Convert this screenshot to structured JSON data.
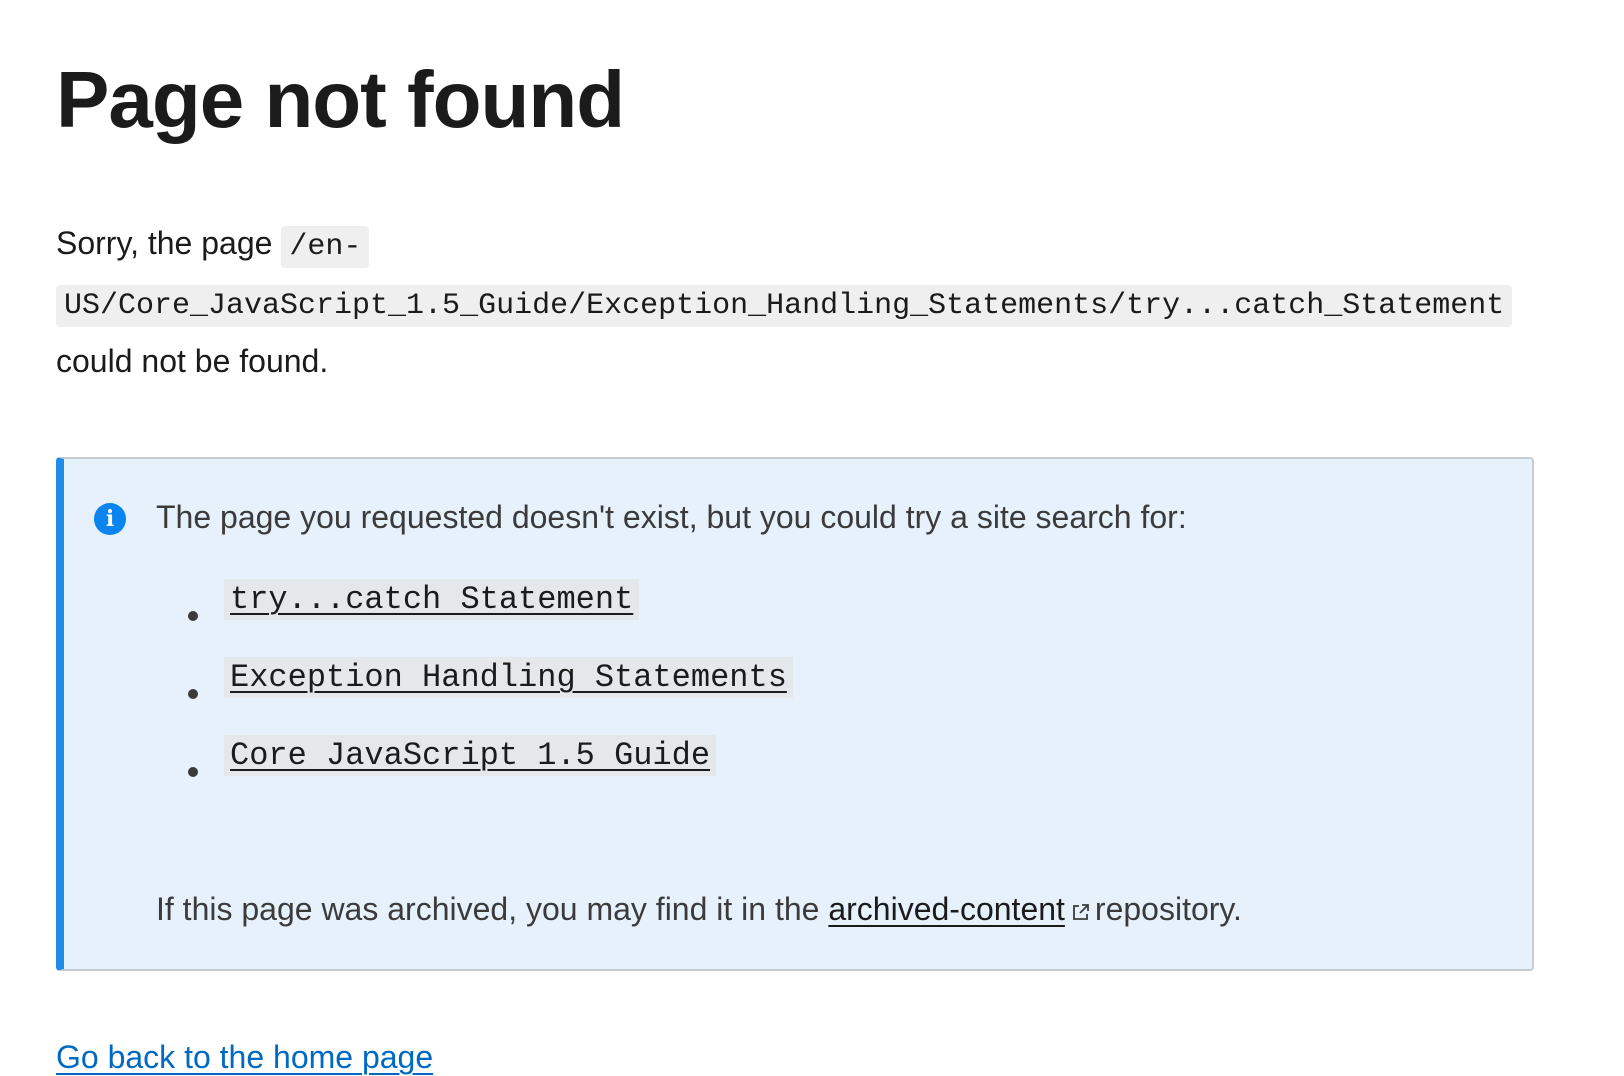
{
  "heading": "Page not found",
  "sorry": {
    "prefix": "Sorry, the page",
    "path": "/en-US/Core_JavaScript_1.5_Guide/Exception_Handling_Statements/try...catch_Statement",
    "suffix": "could not be found."
  },
  "notice": {
    "icon": "info-icon",
    "lead": "The page you requested doesn't exist, but you could try a site search for:",
    "suggestions": [
      "try...catch Statement",
      "Exception Handling Statements",
      "Core JavaScript 1.5 Guide"
    ],
    "archive_prefix": "If this page was archived, you may find it in the",
    "archive_link": "archived-content",
    "archive_suffix": "repository."
  },
  "home_link": "Go back to the home page",
  "colors": {
    "link": "#0069c2",
    "notice_bg": "#e6f1fc",
    "notice_accent": "#1f8ce8",
    "info_icon": "#0a84ef"
  }
}
